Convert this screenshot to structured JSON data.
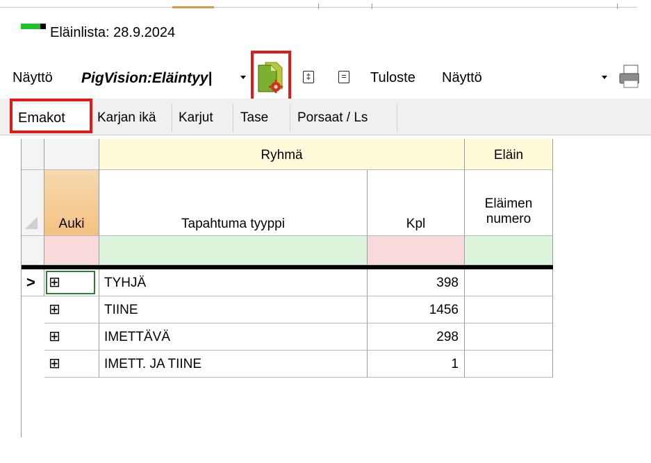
{
  "title": "Eläinlista: 28.9.2024",
  "toolbar": {
    "view_label": "Näyttö",
    "view_selected": "PigVision:Eläintyy|",
    "expand_symbol": "‡",
    "collapse_symbol": "=",
    "print_label": "Tuloste",
    "print_selected": "Näyttö"
  },
  "tabs": [
    "Emakot",
    "Karjan ikä",
    "Karjut",
    "Tase",
    "Porsaat / Ls"
  ],
  "grid": {
    "band_headers": {
      "group": "Ryhmä",
      "animal": "Eläin"
    },
    "columns": {
      "open": "Auki",
      "event_type": "Tapahtuma tyyppi",
      "count": "Kpl",
      "animal_number_1": "Eläimen",
      "animal_number_2": "numero"
    },
    "current_row_marker": ">",
    "rows": [
      {
        "expander": "⊞",
        "event_type": "TYHJÄ",
        "count": "398"
      },
      {
        "expander": "⊞",
        "event_type": "TIINE",
        "count": "1456"
      },
      {
        "expander": "⊞",
        "event_type": "IMETTÄVÄ",
        "count": "298"
      },
      {
        "expander": "⊞",
        "event_type": "IMETT. JA TIINE",
        "count": "1"
      }
    ]
  },
  "colors": {
    "highlight_red": "#e11919",
    "header_yellow": "#fffbd9",
    "filter_green": "#dcf5dc",
    "filter_pink": "#f9dada",
    "auki_header": "#f3c182"
  }
}
